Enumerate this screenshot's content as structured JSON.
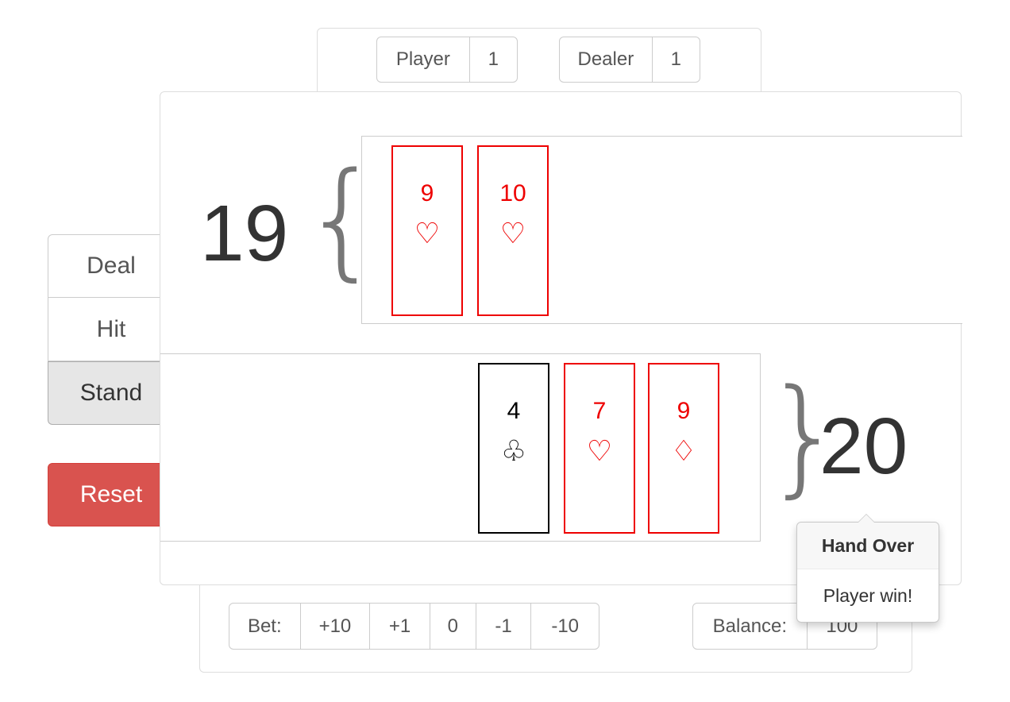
{
  "scoreboard": {
    "player_label": "Player",
    "player_wins": "1",
    "dealer_label": "Dealer",
    "dealer_wins": "1"
  },
  "controls": {
    "deal_label": "Deal",
    "hit_label": "Hit",
    "stand_label": "Stand",
    "reset_label": "Reset"
  },
  "dealer_hand": {
    "total": "19",
    "cards": [
      {
        "rank": "9",
        "suit": "♡",
        "suit_name": "hearts",
        "color": "#e00000"
      },
      {
        "rank": "10",
        "suit": "♡",
        "suit_name": "hearts",
        "color": "#e00000"
      }
    ]
  },
  "player_hand": {
    "total": "20",
    "cards": [
      {
        "rank": "4",
        "suit": "♧",
        "suit_name": "clubs",
        "color": "#000000"
      },
      {
        "rank": "7",
        "suit": "♡",
        "suit_name": "hearts",
        "color": "#e00000"
      },
      {
        "rank": "9",
        "suit": "♢",
        "suit_name": "diamonds",
        "color": "#e00000"
      }
    ]
  },
  "popover": {
    "title": "Hand Over",
    "message": "Player win!"
  },
  "betting": {
    "bet_label": "Bet:",
    "plus_ten": "+10",
    "plus_one": "+1",
    "current_bet": "0",
    "minus_one": "-1",
    "minus_ten": "-10",
    "balance_label": "Balance:",
    "balance_value": "100"
  },
  "colors": {
    "reset_button": "#d9534f",
    "red_suit": "#e00000",
    "stand_active": "#e6e6e6"
  }
}
